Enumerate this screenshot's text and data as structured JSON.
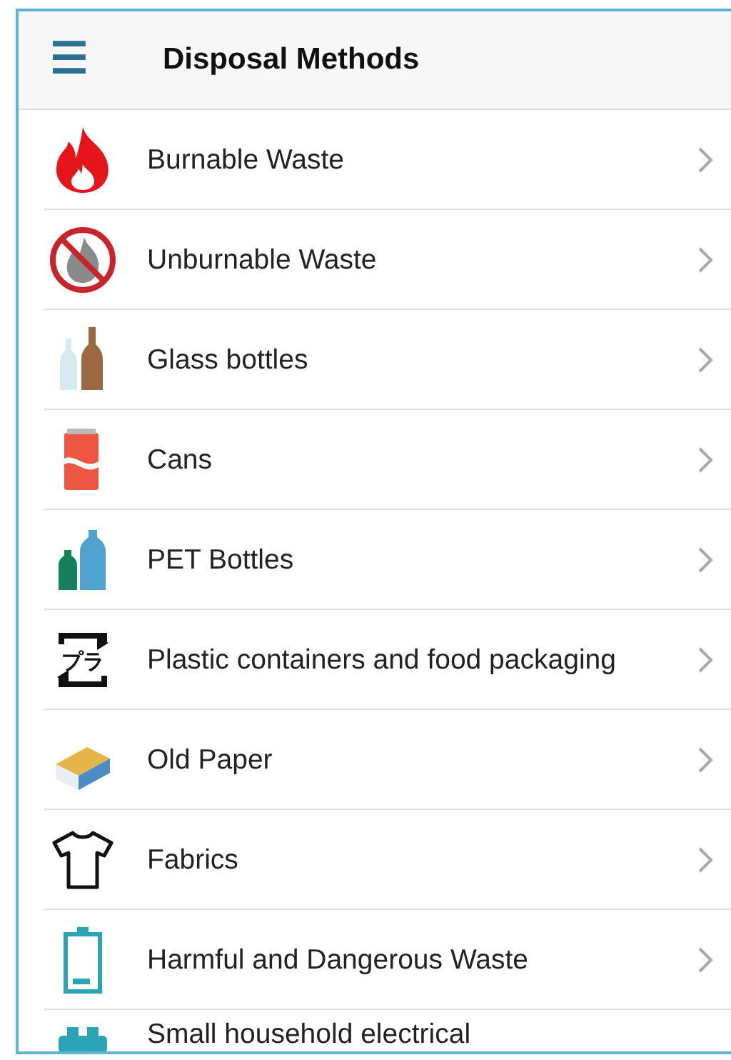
{
  "header": {
    "menu_icon": "☰",
    "title": "Disposal Methods"
  },
  "items": [
    {
      "kind": "fire",
      "label": "Burnable Waste",
      "chevron": true
    },
    {
      "kind": "no-fire",
      "label": "Unburnable Waste",
      "chevron": true
    },
    {
      "kind": "glass",
      "label": "Glass bottles",
      "chevron": true
    },
    {
      "kind": "can",
      "label": "Cans",
      "chevron": true
    },
    {
      "kind": "pet",
      "label": "PET Bottles",
      "chevron": true
    },
    {
      "kind": "plastic",
      "label": "Plastic containers and food packaging",
      "icon_text": "プラ",
      "chevron": true
    },
    {
      "kind": "paper",
      "label": "Old Paper",
      "chevron": true
    },
    {
      "kind": "shirt",
      "label": "Fabrics",
      "chevron": true
    },
    {
      "kind": "battery",
      "label": "Harmful and Dangerous Waste",
      "chevron": true
    },
    {
      "kind": "appliance",
      "label": "Small household electrical",
      "chevron": false
    }
  ]
}
